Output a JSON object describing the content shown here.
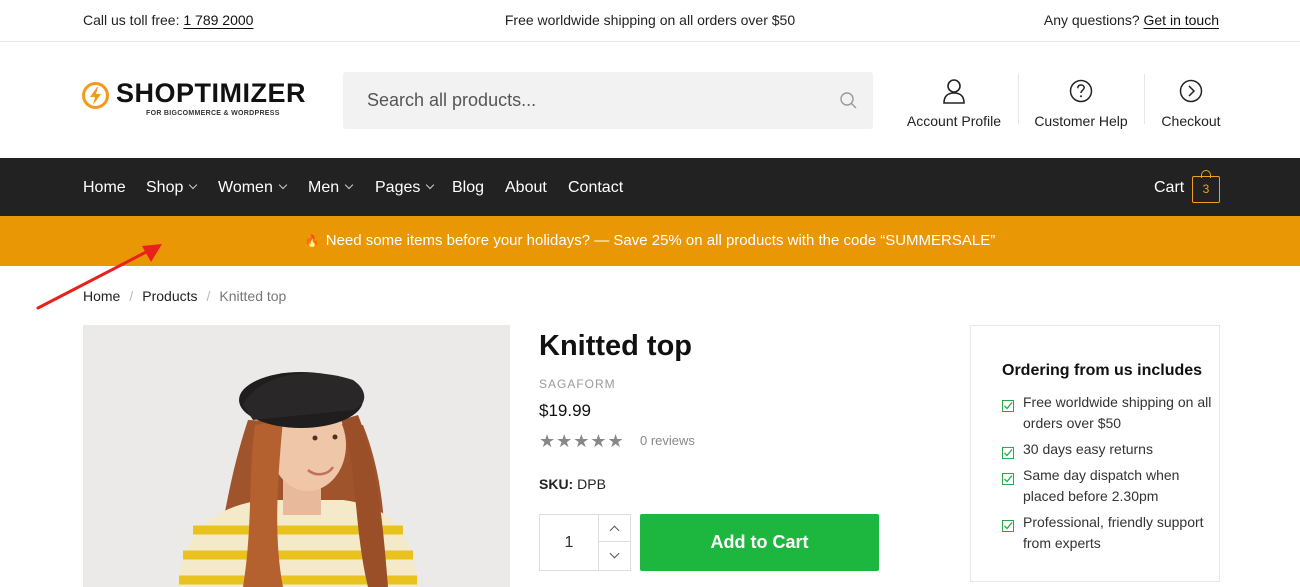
{
  "topbar": {
    "call_prefix": "Call us toll free:",
    "phone": "1 789 2000",
    "shipping": "Free worldwide shipping on all orders over $50",
    "questions_prefix": "Any questions?",
    "get_in_touch": "Get in touch"
  },
  "header": {
    "logo_text": "SHOPTIMIZER",
    "logo_subtext": "FOR BIGCOMMERCE & WORDPRESS",
    "search_placeholder": "Search all products...",
    "links": [
      {
        "label": "Account Profile",
        "icon": "user-icon"
      },
      {
        "label": "Customer Help",
        "icon": "help-circle-icon"
      },
      {
        "label": "Checkout",
        "icon": "chevron-circle-icon"
      }
    ]
  },
  "nav": {
    "items": [
      {
        "label": "Home",
        "dropdown": false
      },
      {
        "label": "Shop",
        "dropdown": true
      },
      {
        "label": "Women",
        "dropdown": true
      },
      {
        "label": "Men",
        "dropdown": true
      },
      {
        "label": "Pages",
        "dropdown": true
      },
      {
        "label": "Blog",
        "dropdown": false
      },
      {
        "label": "About",
        "dropdown": false
      },
      {
        "label": "Contact",
        "dropdown": false
      }
    ],
    "cart_label": "Cart",
    "cart_count": "3"
  },
  "promo": {
    "text": "Need some items before your holidays? — Save 25% on all products with the code “SUMMERSALE”"
  },
  "breadcrumb": {
    "items": [
      "Home",
      "Products",
      "Knitted top"
    ]
  },
  "product": {
    "title": "Knitted top",
    "brand": "SAGAFORM",
    "price": "$19.99",
    "rating_stars": "★★★★★",
    "reviews": "0 reviews",
    "sku_label": "SKU:",
    "sku_value": "DPB",
    "quantity": "1",
    "add_to_cart": "Add to Cart"
  },
  "ordering": {
    "title": "Ordering from us includes",
    "items": [
      "Free worldwide shipping on all orders over $50",
      "30 days easy returns",
      "Same day dispatch when placed before 2.30pm",
      "Professional, friendly support from experts"
    ]
  },
  "colors": {
    "accent": "#ea9706",
    "nav_bg": "#222222",
    "cta": "#1db740"
  }
}
